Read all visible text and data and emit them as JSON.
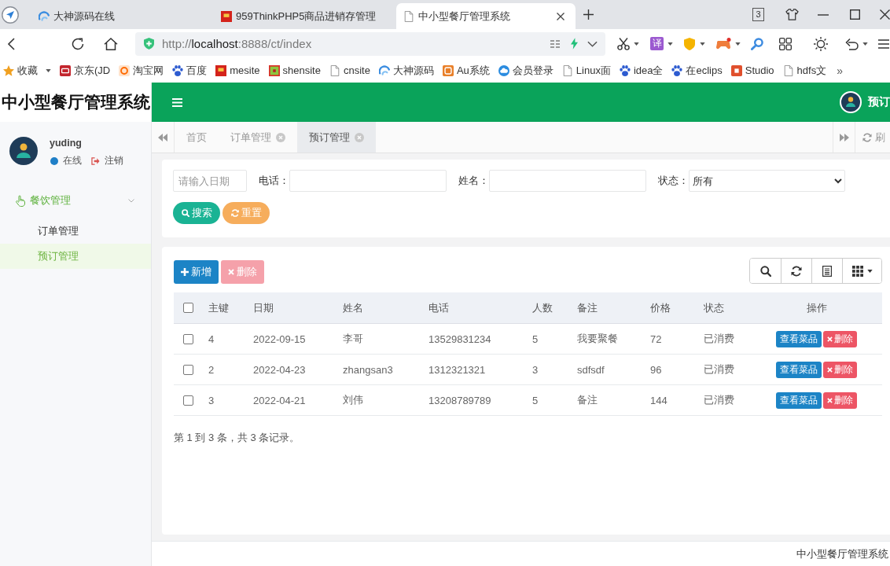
{
  "browser": {
    "tabs": [
      {
        "title": "大神源码在线",
        "kind": "swirl",
        "selected": false
      },
      {
        "title": "959ThinkPHP5商品进销存管理",
        "kind": "red-square",
        "selected": false
      },
      {
        "title": "中小型餐厅管理系统",
        "kind": "doc",
        "selected": true
      }
    ],
    "tab_count": "3",
    "url": {
      "scheme": "http://",
      "host": "localhost",
      "path": ":8888/ct/index"
    },
    "translate_label": "译",
    "bookmarks": [
      {
        "label": "收藏",
        "kind": "star",
        "dropdown": true
      },
      {
        "label": "京东(JD",
        "kind": "jd",
        "dropdown": false
      },
      {
        "label": "淘宝网",
        "kind": "taobao",
        "dropdown": false
      },
      {
        "label": "百度",
        "kind": "paw",
        "dropdown": false
      },
      {
        "label": "mesite",
        "kind": "red-square",
        "dropdown": false
      },
      {
        "label": "shensite",
        "kind": "shen",
        "dropdown": false
      },
      {
        "label": "cnsite",
        "kind": "doc",
        "dropdown": false
      },
      {
        "label": "大神源码",
        "kind": "swirl",
        "dropdown": false
      },
      {
        "label": "Au系统",
        "kind": "au",
        "dropdown": false
      },
      {
        "label": "会员登录",
        "kind": "cloud",
        "dropdown": false
      },
      {
        "label": "Linux面",
        "kind": "doc",
        "dropdown": false
      },
      {
        "label": "idea全",
        "kind": "paw",
        "dropdown": false
      },
      {
        "label": "在eclips",
        "kind": "paw",
        "dropdown": false
      },
      {
        "label": "Studio",
        "kind": "c-logo",
        "dropdown": false
      },
      {
        "label": "hdfs文",
        "kind": "doc",
        "dropdown": false
      }
    ],
    "bookmarks_more": "»"
  },
  "sidebar": {
    "title": "中小型餐厅管理系统",
    "user": {
      "name": "yuding",
      "status": "在线",
      "logout": "注销"
    },
    "menu": [
      {
        "label": "餐饮管理",
        "expanded": true,
        "children": [
          {
            "label": "订单管理",
            "selected": false
          },
          {
            "label": "预订管理",
            "selected": true
          }
        ]
      }
    ]
  },
  "header": {
    "user": "预订"
  },
  "page_tabs": {
    "tabs": [
      {
        "label": "首页",
        "selected": false,
        "closable": false
      },
      {
        "label": "订单管理",
        "selected": false,
        "closable": true
      },
      {
        "label": "预订管理",
        "selected": true,
        "closable": true
      }
    ],
    "refresh": "刷"
  },
  "search_panel": {
    "fields": [
      {
        "kind": "text",
        "placeholder": "请输入日期"
      },
      {
        "kind": "text",
        "label": "电话："
      },
      {
        "kind": "text",
        "label": "姓名："
      },
      {
        "kind": "select",
        "label": "状态：",
        "value": "所有"
      }
    ],
    "buttons": [
      {
        "kind": "search",
        "label": "搜索"
      },
      {
        "kind": "reset",
        "label": "重置"
      }
    ]
  },
  "table_panel": {
    "buttons": [
      {
        "kind": "add",
        "label": "新增",
        "disabled": false
      },
      {
        "kind": "delete",
        "label": "删除",
        "disabled": true
      }
    ],
    "table": {
      "all_checked": false,
      "columns": [
        "主键",
        "日期",
        "姓名",
        "电话",
        "人数",
        "备注",
        "价格",
        "状态",
        "操作"
      ],
      "rows": [
        {
          "checked": false,
          "cells": [
            "4",
            "2022-09-15",
            "李哥",
            "13529831234",
            "5",
            "我要聚餐",
            "72",
            "已消费"
          ],
          "actions": [
            {
              "kind": "view",
              "label": "查看菜品"
            },
            {
              "kind": "delete",
              "label": "删除"
            }
          ]
        },
        {
          "checked": false,
          "cells": [
            "2",
            "2022-04-23",
            "zhangsan3",
            "1312321321",
            "3",
            "sdfsdf",
            "96",
            "已消费"
          ],
          "actions": [
            {
              "kind": "view",
              "label": "查看菜品"
            },
            {
              "kind": "delete",
              "label": "删除"
            }
          ]
        },
        {
          "checked": false,
          "cells": [
            "3",
            "2022-04-21",
            "刘伟",
            "13208789789",
            "5",
            "备注",
            "144",
            "已消费"
          ],
          "actions": [
            {
              "kind": "view",
              "label": "查看菜品"
            },
            {
              "kind": "delete",
              "label": "删除"
            }
          ]
        }
      ]
    },
    "summary": "第 1 到 3 条，共 3 条记录。"
  },
  "footer": "中小型餐厅管理系统"
}
